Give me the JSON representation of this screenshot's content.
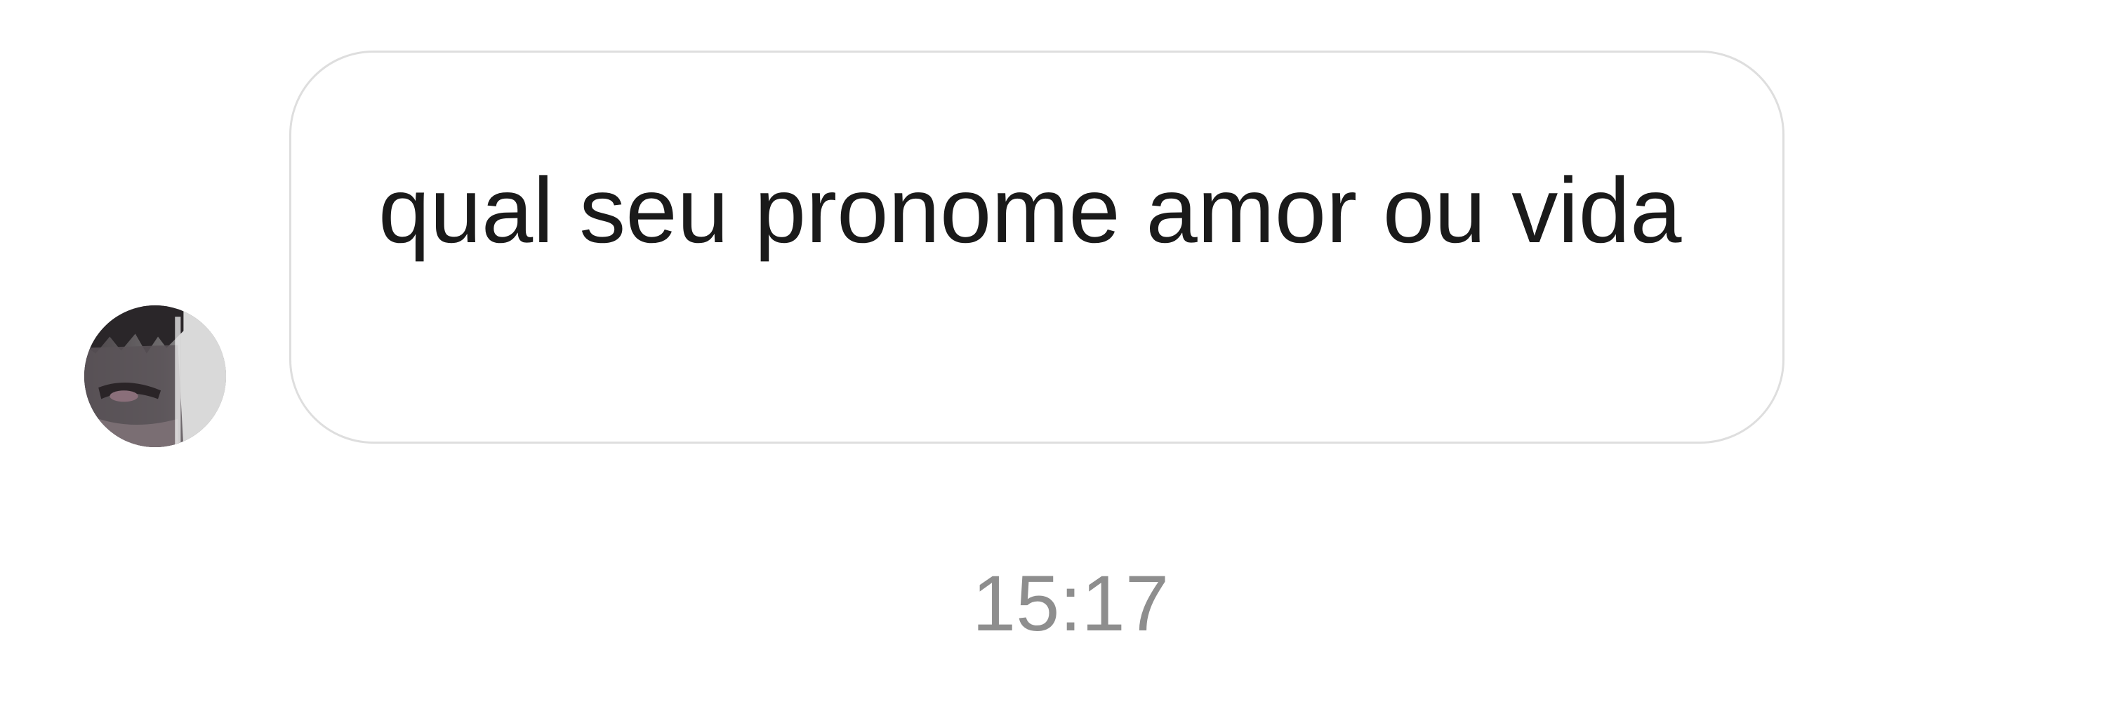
{
  "conversation": {
    "messages": [
      {
        "text": "qual seu pronome amor ou vida",
        "time": "15:17"
      }
    ],
    "sender_avatar_icon": "profile-photo-avatar",
    "colors": {
      "background": "#ffffff",
      "bubble_border": "#dedede",
      "message_text": "#1a1a1a",
      "timestamp_text": "#8e8e8e"
    }
  }
}
